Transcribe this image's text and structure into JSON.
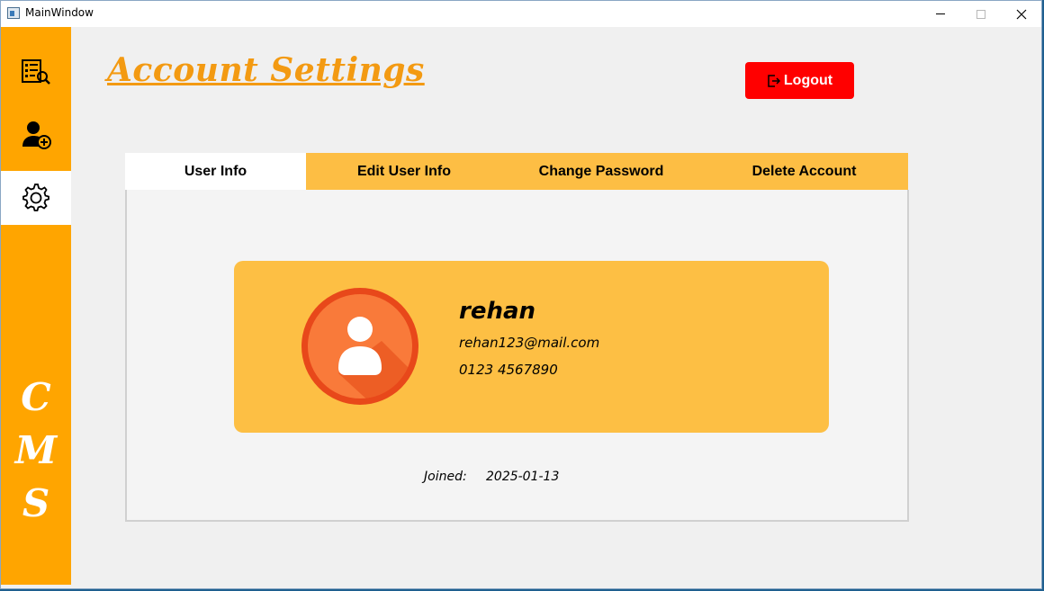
{
  "window": {
    "title": "MainWindow"
  },
  "sidebar": {
    "items": [
      {
        "icon": "report-search-icon",
        "active": false
      },
      {
        "icon": "add-user-icon",
        "active": false
      },
      {
        "icon": "gear-icon",
        "active": true
      }
    ],
    "brand_letters": [
      "C",
      "M",
      "S"
    ]
  },
  "header": {
    "title": "Account Settings",
    "logout_label": "Logout"
  },
  "tabs": [
    {
      "label": "User Info",
      "active": true
    },
    {
      "label": "Edit User Info",
      "active": false
    },
    {
      "label": "Change Password",
      "active": false
    },
    {
      "label": "Delete Account",
      "active": false
    }
  ],
  "user": {
    "name": "rehan",
    "email": "rehan123@mail.com",
    "phone": "0123 4567890",
    "joined_label": "Joined:",
    "joined_date": "2025-01-13"
  },
  "colors": {
    "sidebar": "#ffa500",
    "tab_bar": "#fdbe44",
    "card": "#fdbf44",
    "title": "#f39a12",
    "logout": "#ff0000"
  }
}
